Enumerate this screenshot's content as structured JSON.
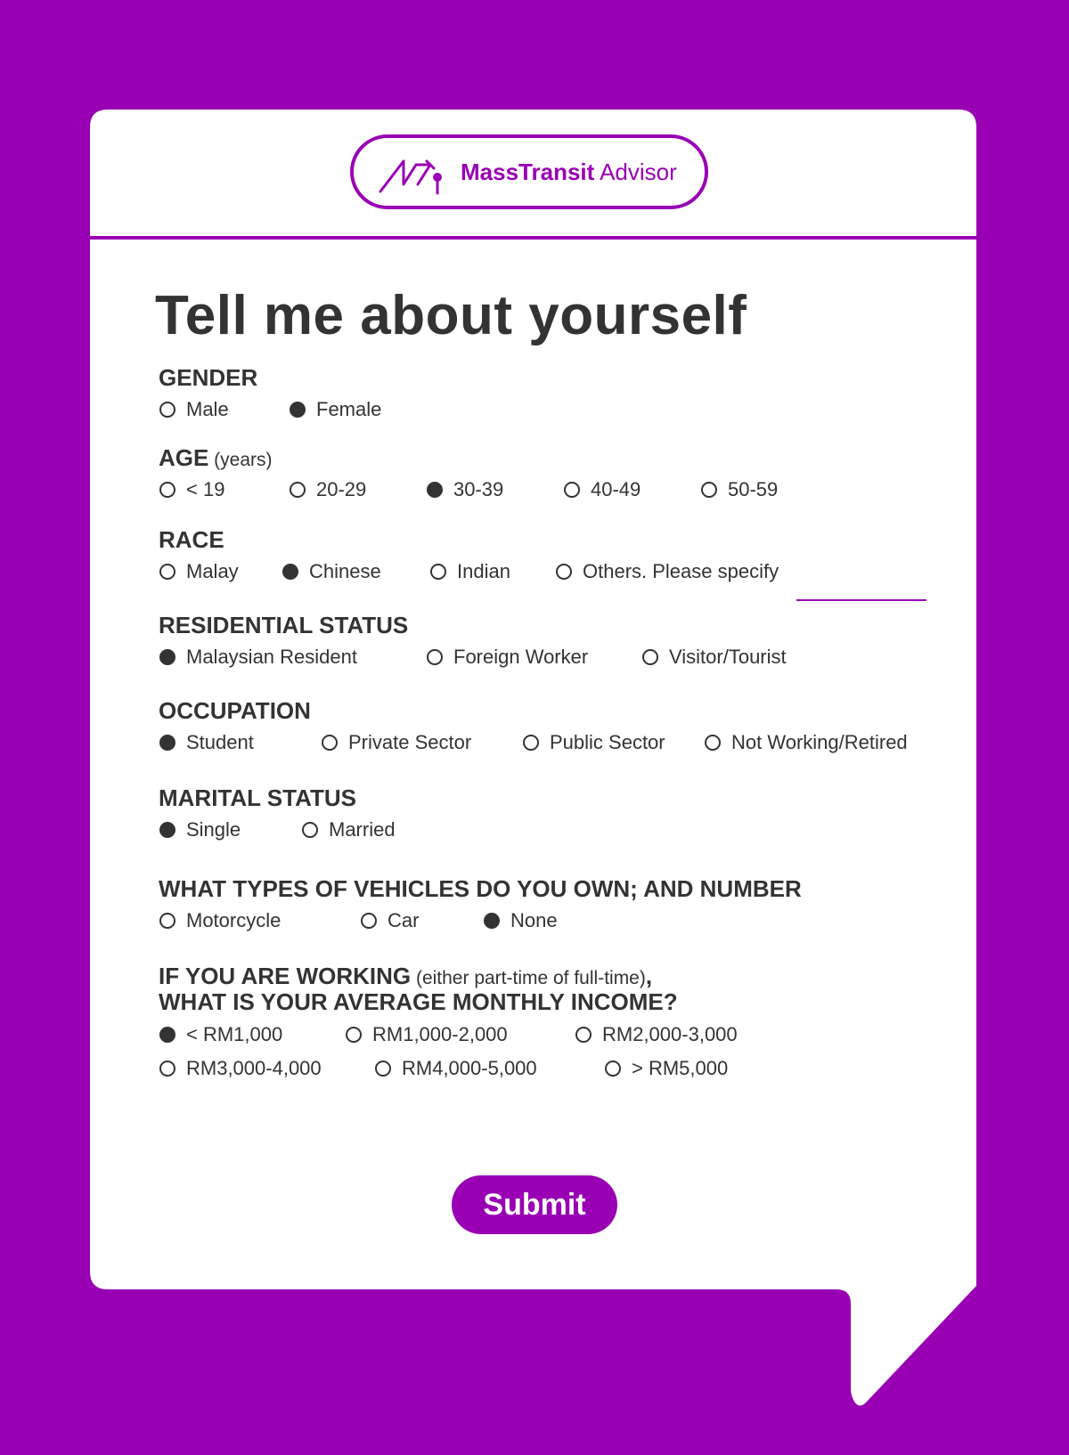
{
  "brand": {
    "name_bold": "MassTransit",
    "name_regular": " Advisor",
    "icon": "transit-logo-icon",
    "color": "#9900b4"
  },
  "title": "Tell me about yourself",
  "sections": {
    "gender": {
      "heading": "GENDER",
      "options": [
        "Male",
        "Female"
      ],
      "selected": "Female"
    },
    "age": {
      "heading": "AGE",
      "note": " (years)",
      "options": [
        "< 19",
        "20-29",
        "30-39",
        "40-49",
        "50-59"
      ],
      "selected": "30-39"
    },
    "race": {
      "heading": "RACE",
      "options": [
        "Malay",
        "Chinese",
        "Indian",
        "Others. Please specify"
      ],
      "selected": "Chinese",
      "specify_value": ""
    },
    "residential": {
      "heading": "RESIDENTIAL STATUS",
      "options": [
        "Malaysian Resident",
        "Foreign Worker",
        "Visitor/Tourist"
      ],
      "selected": "Malaysian Resident"
    },
    "occupation": {
      "heading": "OCCUPATION",
      "options": [
        "Student",
        "Private Sector",
        "Public Sector",
        "Not Working/Retired"
      ],
      "selected": "Student"
    },
    "marital": {
      "heading": "MARITAL STATUS",
      "options": [
        "Single",
        "Married"
      ],
      "selected": "Single"
    },
    "vehicles": {
      "heading": "WHAT TYPES OF VEHICLES DO YOU OWN; AND NUMBER",
      "options": [
        "Motorcycle",
        "Car",
        "None"
      ],
      "selected": "None"
    },
    "income": {
      "heading_part1": "IF YOU ARE WORKING",
      "heading_note": " (either part-time of full-time)",
      "heading_comma": ",",
      "heading_line2": "WHAT IS YOUR AVERAGE MONTHLY INCOME?",
      "options": [
        "< RM1,000",
        "RM1,000-2,000",
        "RM2,000-3,000",
        "RM3,000-4,000",
        "RM4,000-5,000",
        "> RM5,000"
      ],
      "selected": "< RM1,000"
    }
  },
  "submit_label": "Submit"
}
